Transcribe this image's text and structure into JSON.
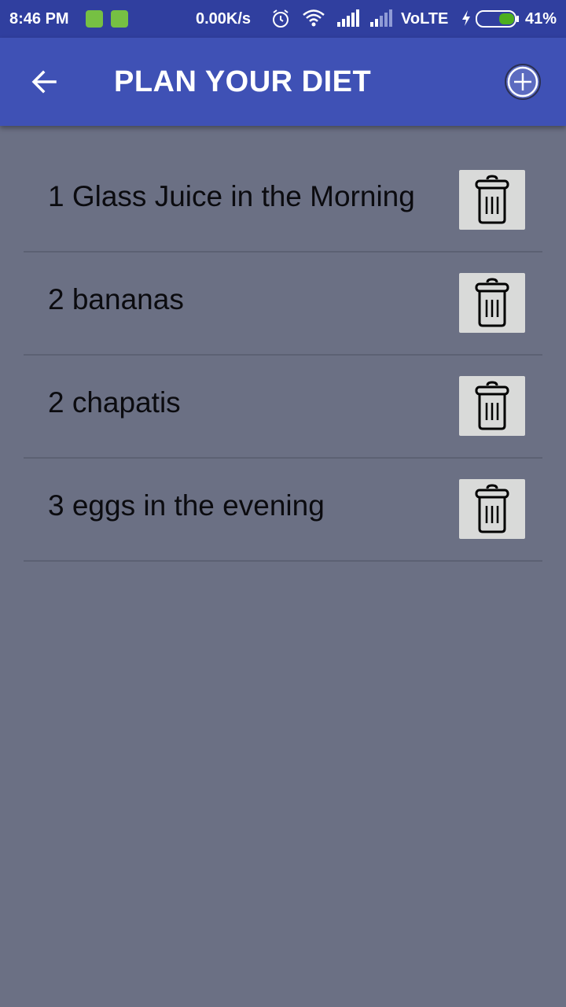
{
  "status_bar": {
    "time": "8:46 PM",
    "net_speed": "0.00K/s",
    "network": "VoLTE",
    "battery_percent": "41%",
    "battery_level": 0.41,
    "icons": [
      "notification-app-icon",
      "android-icon",
      "alarm-icon",
      "wifi-icon",
      "signal-icon",
      "signal-weak-icon",
      "charging-icon",
      "battery-icon"
    ]
  },
  "app_bar": {
    "title": "PLAN YOUR DIET",
    "back_icon": "arrow-back-icon",
    "add_icon": "add-circle-icon",
    "color": "#3f51b5"
  },
  "diet_items": [
    {
      "label": "1 Glass Juice in the Morning",
      "action_icon": "trash-icon"
    },
    {
      "label": "2 bananas",
      "action_icon": "trash-icon"
    },
    {
      "label": "2 chapatis",
      "action_icon": "trash-icon"
    },
    {
      "label": "3 eggs in the evening",
      "action_icon": "trash-icon"
    }
  ],
  "colors": {
    "status_bar": "#303f9f",
    "app_bar": "#3f51b5",
    "background": "#6b7084",
    "delete_button": "#d9dad9",
    "battery_fill": "#4caf1e"
  }
}
